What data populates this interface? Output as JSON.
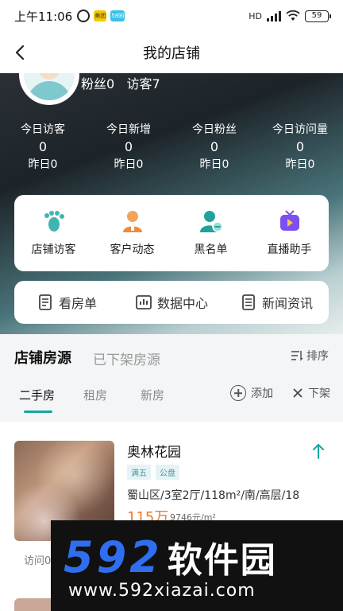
{
  "status_bar": {
    "time": "上午11:06",
    "app_badges": [
      "美团",
      "58同城"
    ],
    "network": "HD",
    "battery": "59"
  },
  "nav": {
    "title": "我的店铺"
  },
  "profile": {
    "fans_label": "粉丝0",
    "visitors_label": "访客7"
  },
  "stats": [
    {
      "label": "今日访客",
      "value": "0",
      "yesterday": "昨日0"
    },
    {
      "label": "今日新增",
      "value": "0",
      "yesterday": "昨日0"
    },
    {
      "label": "今日粉丝",
      "value": "0",
      "yesterday": "昨日0"
    },
    {
      "label": "今日访问量",
      "value": "0",
      "yesterday": "昨日0"
    }
  ],
  "actions": [
    {
      "label": "店铺访客",
      "icon": "footprint-icon",
      "color": "#3fb5b0"
    },
    {
      "label": "客户动态",
      "icon": "customer-icon",
      "color": "#f08a3c"
    },
    {
      "label": "黑名单",
      "icon": "blacklist-icon",
      "color": "#1fa39b"
    },
    {
      "label": "直播助手",
      "icon": "live-tv-icon",
      "color": "#7b4ff0"
    }
  ],
  "links": [
    {
      "label": "看房单",
      "icon": "document-icon"
    },
    {
      "label": "数据中心",
      "icon": "chart-icon"
    },
    {
      "label": "新闻资讯",
      "icon": "news-icon"
    }
  ],
  "tabs": {
    "main": "店铺房源",
    "off": "已下架房源",
    "sort": "排序"
  },
  "subtabs": {
    "items": [
      "二手房",
      "租房",
      "新房"
    ],
    "active_index": 0,
    "add": "添加",
    "remove": "下架"
  },
  "listing": {
    "title": "奥林花园",
    "tags": [
      "满五",
      "公盘"
    ],
    "desc": "蜀山区/3室2厅/118m²/南/高层/18",
    "price": "115万",
    "unit_price": "9746元/m²",
    "visit_text": "访问0"
  },
  "watermark": {
    "digits": "592",
    "cn": "软件园",
    "url": "www.592xiazai.com"
  },
  "colors": {
    "accent": "#17a6a0",
    "price": "#ef7b2a",
    "watermark_blue": "#2f6ef0"
  }
}
